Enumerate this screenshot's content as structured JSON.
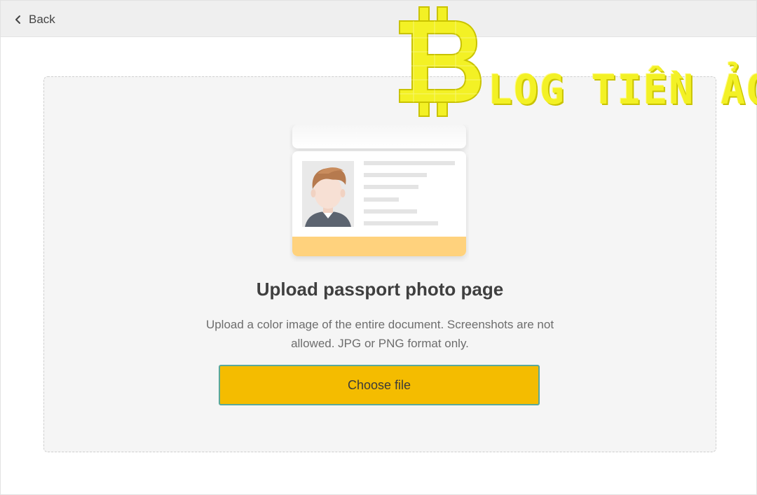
{
  "header": {
    "back_label": "Back"
  },
  "upload": {
    "title": "Upload passport photo page",
    "description": "Upload a color image of the entire document. Screenshots are not allowed. JPG or PNG format only.",
    "button_label": "Choose file"
  },
  "watermark": {
    "text": "LOG TIỀN ẢO"
  },
  "colors": {
    "accent": "#f4bc00",
    "button_border": "#5aa89a",
    "card_stripe": "#ffd27d",
    "watermark": "#f3f125"
  }
}
